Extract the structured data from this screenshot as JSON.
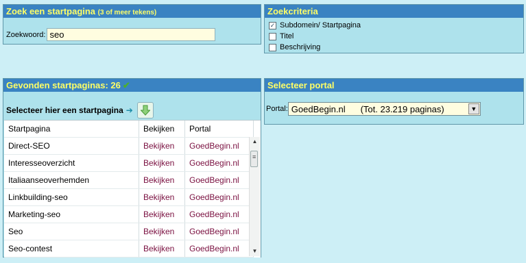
{
  "search": {
    "title": "Zoek een startpagina",
    "title_hint": "(3 of meer tekens)",
    "label": "Zoekwoord:",
    "value": "seo"
  },
  "criteria": {
    "title": "Zoekcriteria",
    "options": [
      {
        "label": "Subdomein/ Startpagina",
        "checked": true
      },
      {
        "label": "Titel",
        "checked": false
      },
      {
        "label": "Beschrijving",
        "checked": false
      }
    ]
  },
  "results": {
    "title": "Gevonden startpaginas: 26",
    "select_label": "Selecteer hier een startpagina",
    "columns": [
      "Startpagina",
      "Bekijken",
      "Portal"
    ],
    "rows": [
      [
        "Direct-SEO",
        "Bekijken",
        "GoedBegin.nl"
      ],
      [
        "Interesseoverzicht",
        "Bekijken",
        "GoedBegin.nl"
      ],
      [
        "Italiaanseoverhemden",
        "Bekijken",
        "GoedBegin.nl"
      ],
      [
        "Linkbuilding-seo",
        "Bekijken",
        "GoedBegin.nl"
      ],
      [
        "Marketing-seo",
        "Bekijken",
        "GoedBegin.nl"
      ],
      [
        "Seo",
        "Bekijken",
        "GoedBegin.nl"
      ],
      [
        "Seo-contest",
        "Bekijken",
        "GoedBegin.nl"
      ]
    ]
  },
  "portal": {
    "title": "Selecteer portal",
    "label": "Portal:",
    "selected": "GoedBegin.nl",
    "count": "(Tot. 23.219 paginas)"
  },
  "colors": {
    "background": "#cdeff6",
    "header": "#3a83c2",
    "header_text": "#ffff66",
    "link": "#7a1040"
  }
}
